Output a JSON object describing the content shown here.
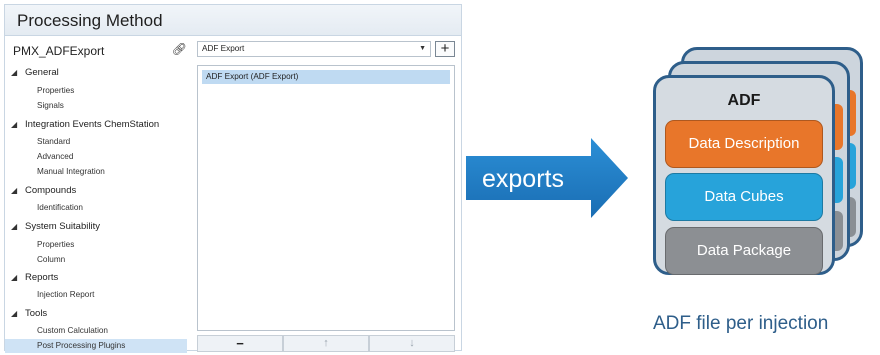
{
  "window": {
    "title": "Processing Method"
  },
  "tree": {
    "method_name": "PMX_ADFExport",
    "groups": [
      {
        "label": "General",
        "items": [
          "Properties",
          "Signals"
        ]
      },
      {
        "label": "Integration Events ChemStation",
        "items": [
          "Standard",
          "Advanced",
          "Manual Integration"
        ]
      },
      {
        "label": "Compounds",
        "items": [
          "Identification"
        ]
      },
      {
        "label": "System Suitability",
        "items": [
          "Properties",
          "Column"
        ]
      },
      {
        "label": "Reports",
        "items": [
          "Injection Report"
        ]
      },
      {
        "label": "Tools",
        "items": [
          "Custom Calculation",
          "Post Processing Plugins"
        ]
      }
    ],
    "selected_item": "Post Processing Plugins"
  },
  "plugin_panel": {
    "dropdown_value": "ADF Export",
    "add_button": "+",
    "list_items": [
      "ADF Export (ADF Export)"
    ],
    "remove_button": "−",
    "up_button": "↑",
    "down_button": "↓"
  },
  "diagram": {
    "arrow_label": "exports",
    "file_header": "ADF",
    "blocks": [
      {
        "label": "Data Description",
        "color": "#e8762a"
      },
      {
        "label": "Data Cubes",
        "color": "#27a3da"
      },
      {
        "label": "Data Package",
        "color": "#8c8f93"
      }
    ],
    "caption": "ADF file per injection"
  }
}
